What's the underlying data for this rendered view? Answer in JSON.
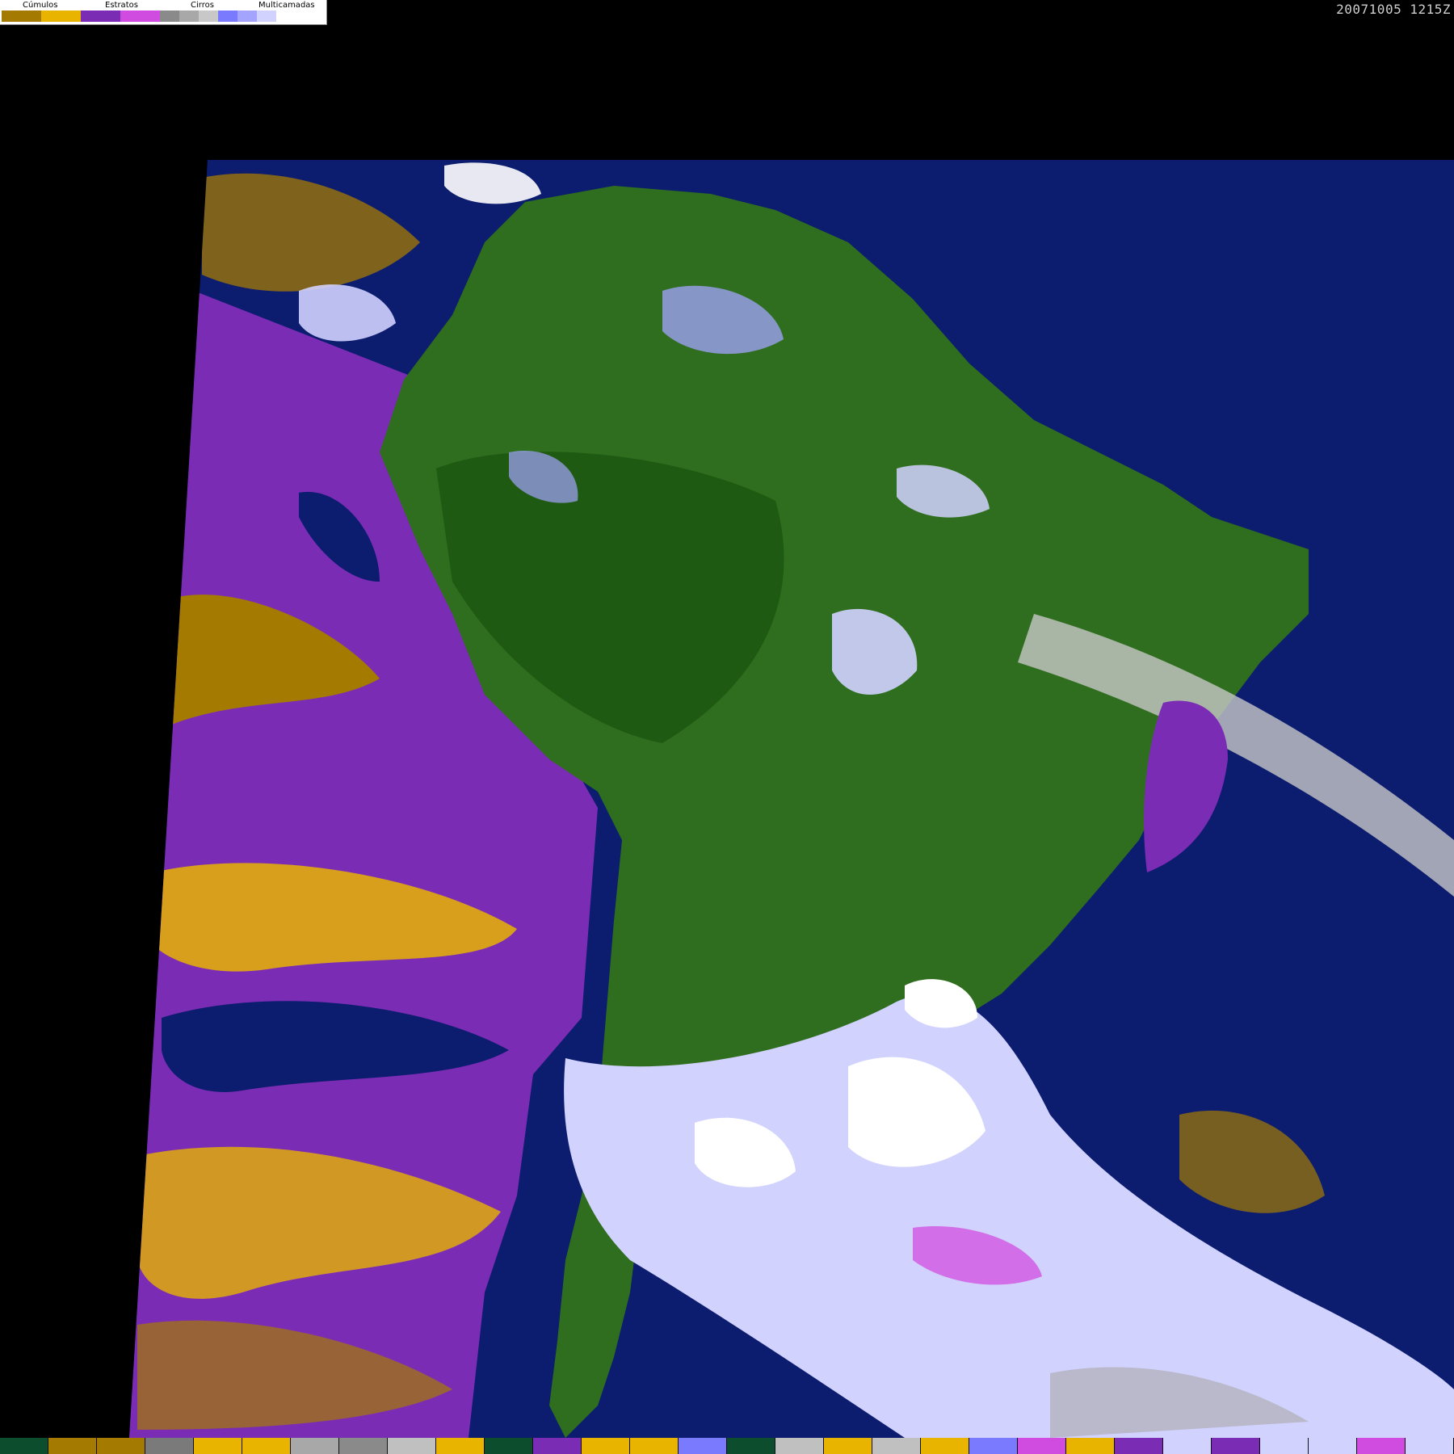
{
  "legend": {
    "groups": [
      {
        "label": "Cúmulos",
        "colors": [
          "#a57a00",
          "#e8b400"
        ]
      },
      {
        "label": "Estratos",
        "colors": [
          "#7b2cb4",
          "#d04ce0"
        ]
      },
      {
        "label": "Cirros",
        "colors": [
          "#8a8a8a",
          "#a8a8a8",
          "#c8c8c8"
        ]
      },
      {
        "label": "Multicamadas",
        "colors": [
          "#7a7aff",
          "#a4a4ff",
          "#d2d2ff",
          "#ffffff"
        ]
      }
    ]
  },
  "timestamp": "20071005 1215Z",
  "palette": {
    "ocean": "#0c1c6e",
    "land": "#2f6e1e",
    "cumulus_dark": "#a57a00",
    "cumulus_light": "#e8b400",
    "stratus_dark": "#7b2cb4",
    "stratus_light": "#d04ce0",
    "multilayer": "#d2d2ff",
    "cirrus": "#a8a8a8"
  },
  "bottom_strip": [
    "#0b4d2c",
    "#a57a00",
    "#a57a00",
    "#7a7a7a",
    "#e8b400",
    "#e8b400",
    "#a8a8a8",
    "#8a8a8a",
    "#c0c0c0",
    "#e8b400",
    "#0b4d2c",
    "#7b2cb4",
    "#e8b400",
    "#e8b400",
    "#7a7aff",
    "#0b4d2c",
    "#c0c0c0",
    "#e8b400",
    "#c0c0c0",
    "#e8b400",
    "#7a7aff",
    "#d04ce0",
    "#e8b400",
    "#7b2cb4",
    "#d2d2ff",
    "#7b2cb4",
    "#d2d2ff",
    "#d2d2ff",
    "#d04ce0",
    "#d2d2ff"
  ]
}
